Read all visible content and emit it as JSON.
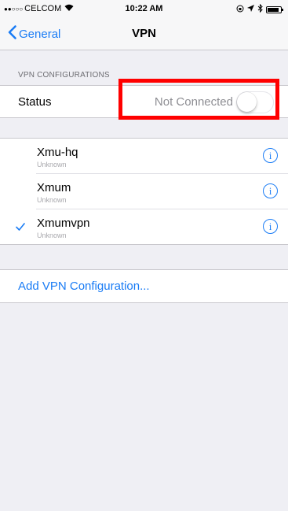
{
  "status_bar": {
    "signal_dots": "●●○○○",
    "carrier": "CELCOM",
    "wifi_icon": "wifi-icon",
    "time": "10:22 AM",
    "icons": [
      "lock-rotation-icon",
      "location-icon",
      "bluetooth-icon",
      "battery-icon"
    ]
  },
  "nav": {
    "back_label": "General",
    "title": "VPN"
  },
  "vpn_section": {
    "header": "VPN CONFIGURATIONS",
    "status_label": "Status",
    "status_value": "Not Connected",
    "toggle_on": false
  },
  "configurations": [
    {
      "name": "Xmu-hq",
      "subtitle": "Unknown",
      "selected": false
    },
    {
      "name": "Xmum",
      "subtitle": "Unknown",
      "selected": false
    },
    {
      "name": "Xmumvpn",
      "subtitle": "Unknown",
      "selected": true
    }
  ],
  "add_configuration_label": "Add VPN Configuration...",
  "colors": {
    "accent": "#1a7cf5",
    "highlight": "#ff0000",
    "background": "#efeff4"
  }
}
